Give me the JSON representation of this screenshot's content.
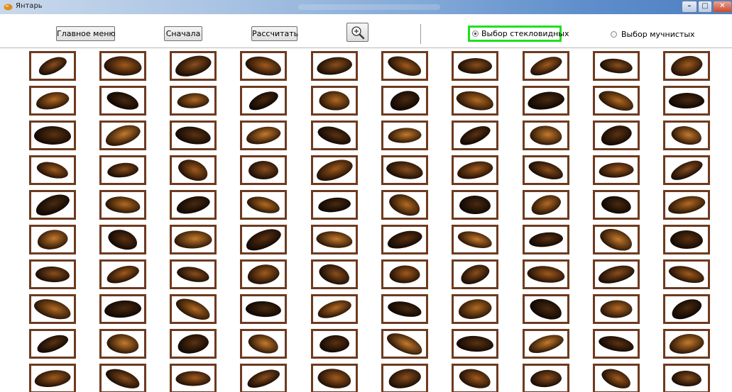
{
  "window": {
    "title": "Янтарь",
    "icon": "amber-app-icon",
    "controls": {
      "minimize": "–",
      "maximize": "□",
      "close": "✕"
    }
  },
  "toolbar": {
    "main_menu_label": "Главное меню",
    "start_over_label": "Сначала",
    "calculate_label": "Рассчитать",
    "zoom_icon": "zoom-in-icon"
  },
  "selection": {
    "options": [
      {
        "label": "Выбор стекловидных",
        "selected": true,
        "highlight": "#1ee01e"
      },
      {
        "label": "Выбор мучнистых",
        "selected": false
      }
    ]
  },
  "grid": {
    "rows": 10,
    "columns": 10,
    "frame_color": "#6e3a1f",
    "item": "grain-image"
  }
}
